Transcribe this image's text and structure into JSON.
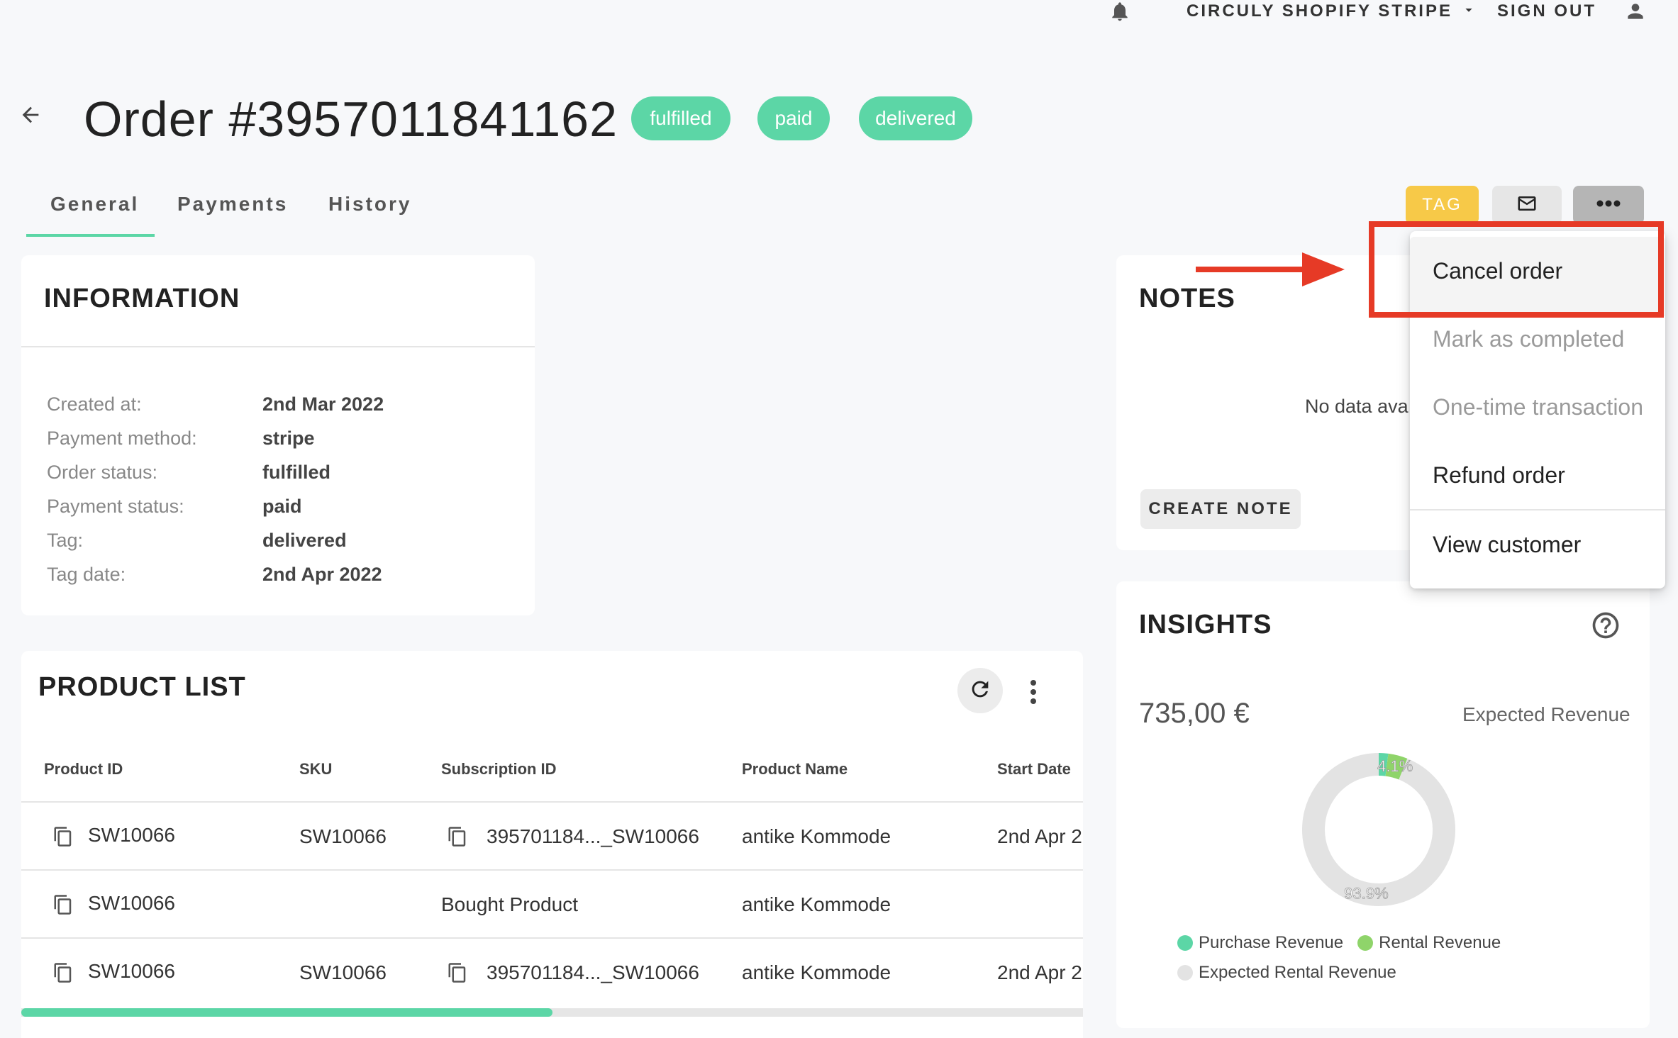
{
  "topbar": {
    "store_name": "CIRCULY SHOPIFY STRIPE",
    "sign_out": "SIGN OUT"
  },
  "header": {
    "title": "Order #3957011841162",
    "badges": [
      "fulfilled",
      "paid",
      "delivered"
    ],
    "badge_color": "#5cd6a6"
  },
  "tabs": [
    "General",
    "Payments",
    "History"
  ],
  "toolbar": {
    "tag_label": "TAG"
  },
  "information": {
    "title": "INFORMATION",
    "rows": [
      {
        "label": "Created at:",
        "value": "2nd Mar 2022"
      },
      {
        "label": "Payment method:",
        "value": "stripe"
      },
      {
        "label": "Order status:",
        "value": "fulfilled"
      },
      {
        "label": "Payment status:",
        "value": "paid"
      },
      {
        "label": "Tag:",
        "value": "delivered"
      },
      {
        "label": "Tag date:",
        "value": "2nd Apr 2022"
      }
    ]
  },
  "notes": {
    "title": "NOTES",
    "empty_text": "No data ava",
    "create_label": "CREATE NOTE"
  },
  "menu": {
    "items": [
      {
        "label": "Cancel order",
        "enabled": true
      },
      {
        "label": "Mark as completed",
        "enabled": false
      },
      {
        "label": "One-time transaction",
        "enabled": false
      },
      {
        "label": "Refund order",
        "enabled": true
      },
      {
        "label": "View customer",
        "enabled": true
      }
    ]
  },
  "products": {
    "title": "PRODUCT LIST",
    "columns": [
      "Product ID",
      "SKU",
      "Subscription ID",
      "Product Name",
      "Start Date"
    ],
    "rows": [
      {
        "product_id": "SW10066",
        "sku": "SW10066",
        "subscription_id": "395701184..._SW10066",
        "product_name": "antike Kommode",
        "start_date": "2nd Apr 2"
      },
      {
        "product_id": "SW10066",
        "sku": "",
        "subscription_id": "Bought Product",
        "product_name": "antike Kommode",
        "start_date": ""
      },
      {
        "product_id": "SW10066",
        "sku": "SW10066",
        "subscription_id": "395701184..._SW10066",
        "product_name": "antike Kommode",
        "start_date": "2nd Apr 2"
      }
    ],
    "scroll_progress": 0.5
  },
  "insights": {
    "title": "INSIGHTS",
    "amount": "735,00 €",
    "amount_label": "Expected Revenue",
    "chart_data": {
      "type": "pie",
      "labels": [
        "Purchase Revenue",
        "Rental Revenue",
        "Expected Rental Revenue"
      ],
      "values": [
        2.0,
        4.1,
        93.9
      ],
      "data_labels": [
        "",
        "4.1%",
        "93.9%"
      ],
      "colors": [
        "#5cd6a6",
        "#8fd46a",
        "#e3e3e3"
      ],
      "legend_position": "bottom"
    }
  }
}
